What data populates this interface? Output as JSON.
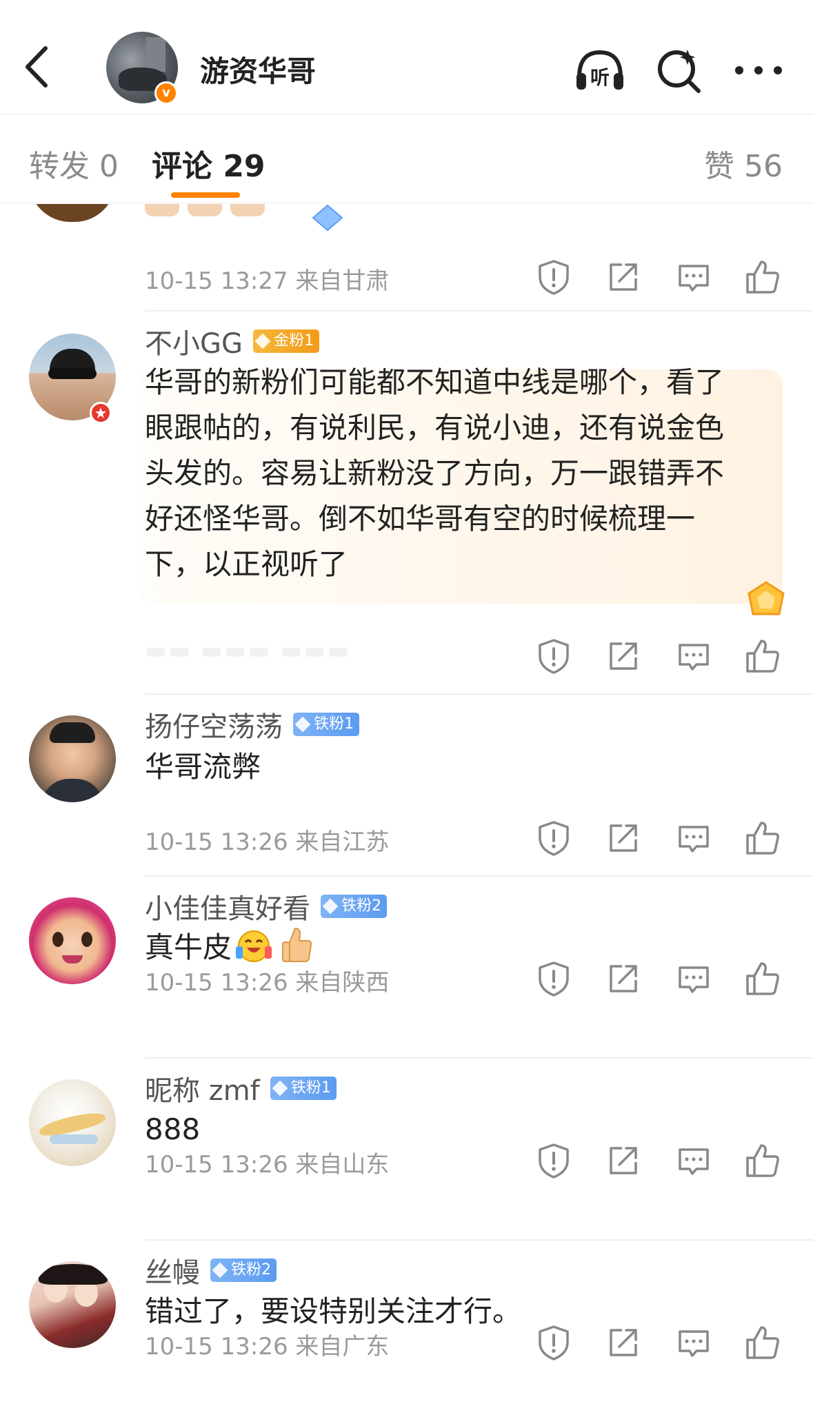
{
  "header": {
    "title": "游资华哥",
    "verified_mark": "v",
    "listen_label": "听",
    "icons": [
      "back-icon",
      "headphones-icon",
      "search-sparkle-icon",
      "more-icon"
    ]
  },
  "tabs": {
    "repost": "转发 0",
    "comments": "评论 29",
    "likes": "赞 56"
  },
  "colors": {
    "accent": "#ff8200",
    "meta": "#9a9a9a",
    "gold_badge": "#f6b83a",
    "iron_badge": "#5b9bf0"
  },
  "partial_comment": {
    "meta": "10-15 13:27  来自甘肃"
  },
  "comments": [
    {
      "name": "不小GG",
      "badge": "金粉1",
      "text_lines": [
        "华哥的新粉们可能都不知道中线是哪个，看了",
        "眼跟帖的，有说利民，有说小迪，还有说金色",
        "头发的。容易让新粉没了方向，万一跟错弄不",
        "好还怪华哥。倒不如华哥有空的时候梳理一",
        "下，以正视听了"
      ]
    },
    {
      "name": "扬仔空荡荡",
      "badge": "铁粉1",
      "text": "华哥流弊",
      "meta": "10-15 13:26  来自江苏"
    },
    {
      "name": "小佳佳真好看",
      "badge": "铁粉2",
      "text": "真牛皮",
      "meta": "10-15 13:26  来自陕西"
    },
    {
      "name": "昵称 zmf",
      "badge": "铁粉1",
      "text": "888",
      "meta": "10-15 13:26  来自山东"
    },
    {
      "name": "丝幔",
      "badge": "铁粉2",
      "text": "错过了，要设特别关注才行。",
      "meta": "10-15 13:26  来自广东"
    }
  ]
}
